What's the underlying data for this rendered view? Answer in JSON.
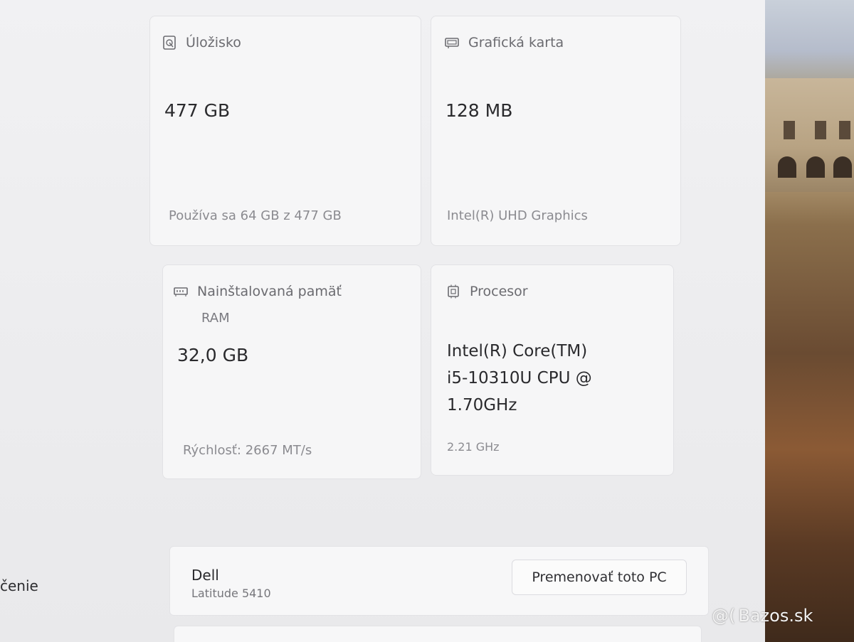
{
  "storage": {
    "title": "Úložisko",
    "value": "477 GB",
    "detail": "Používa sa 64 GB z 477 GB",
    "icon": "hard-drive-icon"
  },
  "gpu": {
    "title": "Grafická karta",
    "value": "128 MB",
    "detail": "Intel(R) UHD Graphics",
    "icon": "graphics-card-icon"
  },
  "ram": {
    "title_line1": "Nainštalovaná pamäť",
    "title_line2": "RAM",
    "value": "32,0 GB",
    "detail": "Rýchlosť: 2667 MT/s",
    "icon": "memory-icon"
  },
  "cpu": {
    "title": "Procesor",
    "value_line1": "Intel(R) Core(TM)",
    "value_line2": "i5-10310U CPU @",
    "value_line3": "1.70GHz",
    "detail": "2.21 GHz",
    "icon": "processor-icon"
  },
  "device": {
    "manufacturer": "Dell",
    "model": "Latitude 5410",
    "rename_button": "Premenovať toto PC"
  },
  "sidebar": {
    "partial_label": "čenie"
  },
  "watermark": {
    "text": "Bazos.sk",
    "symbol": "@("
  }
}
